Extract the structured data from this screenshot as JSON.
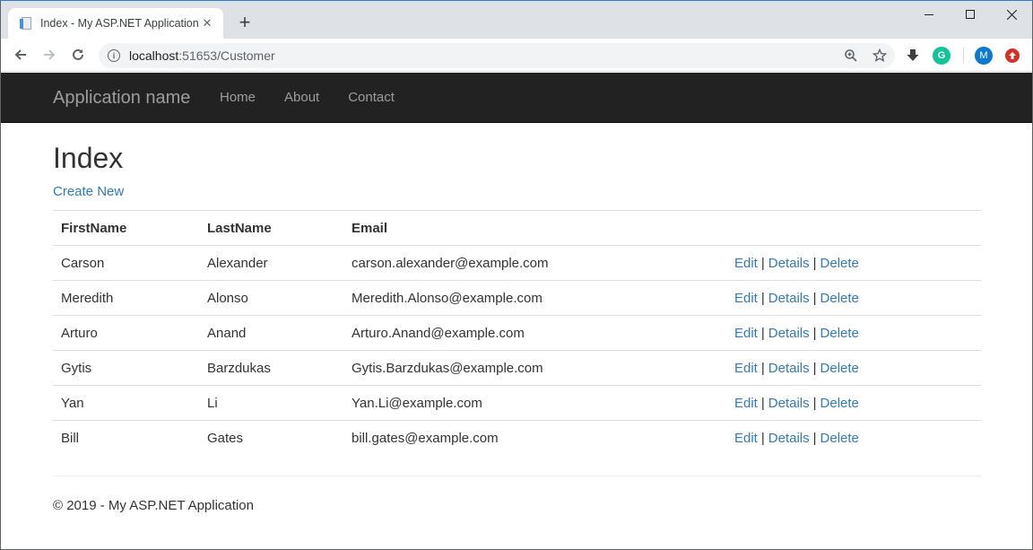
{
  "browser": {
    "tab_title": "Index - My ASP.NET Application",
    "new_tab_symbol": "+",
    "tab_close_symbol": "✕",
    "url_host": "localhost",
    "url_path": ":51653/Customer",
    "extensions": {
      "grammarly": "G",
      "profile": "M"
    }
  },
  "navbar": {
    "brand": "Application name",
    "links": [
      {
        "label": "Home"
      },
      {
        "label": "About"
      },
      {
        "label": "Contact"
      }
    ]
  },
  "page": {
    "title": "Index",
    "create_new": "Create New",
    "table": {
      "headers": [
        "FirstName",
        "LastName",
        "Email"
      ],
      "rows": [
        {
          "first": "Carson",
          "last": "Alexander",
          "email": "carson.alexander@example.com"
        },
        {
          "first": "Meredith",
          "last": "Alonso",
          "email": "Meredith.Alonso@example.com"
        },
        {
          "first": "Arturo",
          "last": "Anand",
          "email": "Arturo.Anand@example.com"
        },
        {
          "first": "Gytis",
          "last": "Barzdukas",
          "email": "Gytis.Barzdukas@example.com"
        },
        {
          "first": "Yan",
          "last": "Li",
          "email": "Yan.Li@example.com"
        },
        {
          "first": "Bill",
          "last": "Gates",
          "email": "bill.gates@example.com"
        }
      ],
      "actions": {
        "edit": "Edit",
        "details": "Details",
        "delete": "Delete",
        "separator": "|"
      }
    },
    "footer": "© 2019 - My ASP.NET Application"
  },
  "colors": {
    "link": "#337ab7",
    "navbar_bg": "#222222",
    "navbar_text": "#9d9d9d"
  }
}
